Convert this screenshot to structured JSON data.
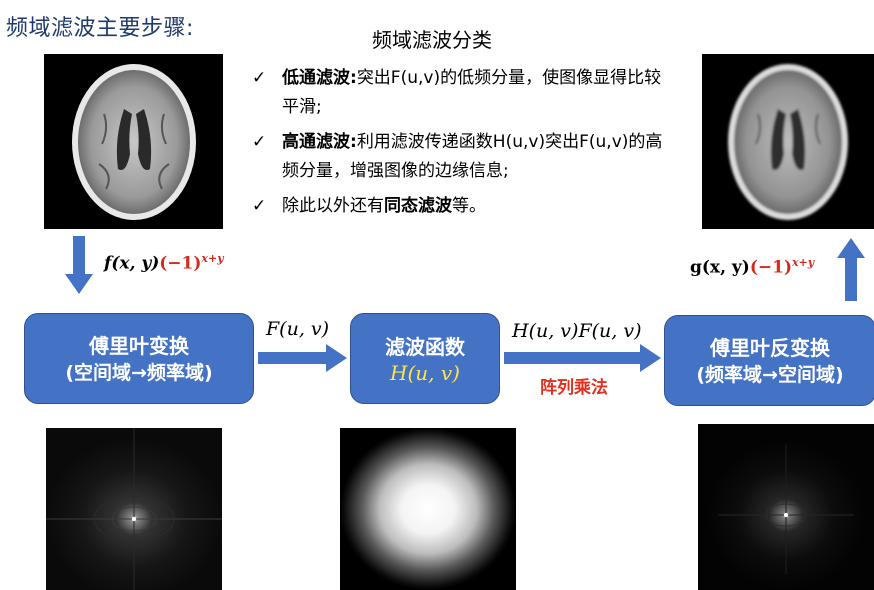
{
  "header": {
    "title": "频域滤波主要步骤:",
    "subtitle": "频域滤波分类"
  },
  "bullets": [
    {
      "bold": "低通滤波:",
      "text": "突出F(u,v)的低频分量，使图像显得比较平滑;"
    },
    {
      "bold": "高通滤波:",
      "text": "利用滤波传递函数H(u,v)突出F(u,v)的高频分量，增强图像的边缘信息;"
    },
    {
      "pre": "除此以外还有",
      "bold": "同态滤波",
      "post": "等。"
    }
  ],
  "input_eq": {
    "func": "f(x, y)",
    "factor": "(−1)",
    "exp": "x+y"
  },
  "output_eq": {
    "func": "g(x, y)",
    "factor": "(−1)",
    "exp": "x+y"
  },
  "boxes": {
    "fft": {
      "line1": "傅里叶变换",
      "line2": "(空间域→频率域)"
    },
    "filter": {
      "line1": "滤波函数",
      "math": "H(u, v)"
    },
    "ifft": {
      "line1": "傅里叶反变换",
      "line2": "(频率域→空间域)"
    }
  },
  "arrows": {
    "a1_label": "F(u, v)",
    "a2_label": "H(u, v)F(u, v)",
    "a2_sublabel": "阵列乘法"
  },
  "images": {
    "input": "mri-brain-image",
    "output": "filtered-mri-brain-image",
    "spectrum": "fourier-spectrum-image",
    "filter": "gaussian-lowpass-filter-image",
    "filtered_spectrum": "filtered-spectrum-image"
  },
  "colors": {
    "box_fill": "#4472c4",
    "arrow_fill": "#4472c4",
    "title_color": "#1f3a6e",
    "highlight_red": "#d62a1e",
    "math_yellow": "#ffe34d"
  }
}
